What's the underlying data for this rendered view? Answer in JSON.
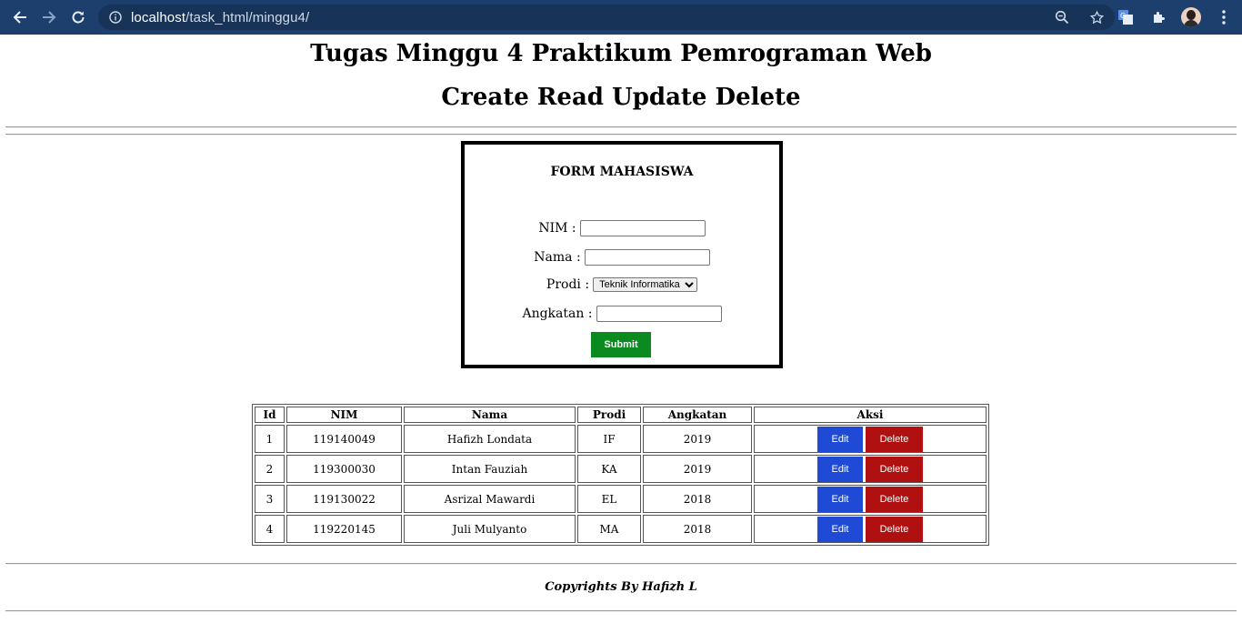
{
  "browser": {
    "url_host": "localhost",
    "url_path": "/task_html/minggu4/"
  },
  "page": {
    "title1": "Tugas Minggu 4 Praktikum Pemrograman Web",
    "title2": "Create Read Update Delete"
  },
  "form": {
    "title": "FORM MAHASISWA",
    "nim_label": "NIM :",
    "nama_label": "Nama :",
    "prodi_label": "Prodi :",
    "prodi_selected": "Teknik Informatika",
    "angkatan_label": "Angkatan :",
    "submit_label": "Submit"
  },
  "table": {
    "headers": [
      "Id",
      "NIM",
      "Nama",
      "Prodi",
      "Angkatan",
      "Aksi"
    ],
    "rows": [
      {
        "id": "1",
        "nim": "119140049",
        "nama": "Hafizh Londata",
        "prodi": "IF",
        "angkatan": "2019"
      },
      {
        "id": "2",
        "nim": "119300030",
        "nama": "Intan Fauziah",
        "prodi": "KA",
        "angkatan": "2019"
      },
      {
        "id": "3",
        "nim": "119130022",
        "nama": "Asrizal Mawardi",
        "prodi": "EL",
        "angkatan": "2018"
      },
      {
        "id": "4",
        "nim": "119220145",
        "nama": "Juli Mulyanto",
        "prodi": "MA",
        "angkatan": "2018"
      }
    ],
    "edit_label": "Edit",
    "delete_label": "Delete"
  },
  "footer": {
    "text": "Copyrights By Hafizh L"
  },
  "colors": {
    "toolbar": "#1d3f6e",
    "submit": "#0a8a1f",
    "edit": "#1f4ad6",
    "delete": "#b01010"
  },
  "icons": [
    "back-arrow-icon",
    "forward-arrow-icon",
    "reload-icon",
    "info-icon",
    "zoom-icon",
    "star-icon",
    "translate-icon",
    "extensions-icon",
    "profile-avatar",
    "menu-dots-icon"
  ]
}
